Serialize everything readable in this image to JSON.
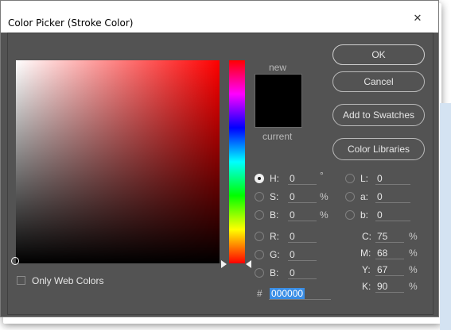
{
  "window": {
    "title": "Color Picker (Stroke Color)",
    "close_glyph": "✕"
  },
  "preview": {
    "new_label": "new",
    "current_label": "current",
    "color": "#000000"
  },
  "buttons": {
    "ok": "OK",
    "cancel": "Cancel",
    "add_to_swatches": "Add to Swatches",
    "color_libraries": "Color Libraries"
  },
  "hsb": [
    {
      "label": "H:",
      "value": "0",
      "unit": "°",
      "selected": true
    },
    {
      "label": "S:",
      "value": "0",
      "unit": "%",
      "selected": false
    },
    {
      "label": "B:",
      "value": "0",
      "unit": "%",
      "selected": false
    }
  ],
  "rgb": [
    {
      "label": "R:",
      "value": "0"
    },
    {
      "label": "G:",
      "value": "0"
    },
    {
      "label": "B:",
      "value": "0"
    }
  ],
  "lab": [
    {
      "label": "L:",
      "value": "0"
    },
    {
      "label": "a:",
      "value": "0"
    },
    {
      "label": "b:",
      "value": "0"
    }
  ],
  "cmyk": [
    {
      "label": "C:",
      "value": "75",
      "unit": "%"
    },
    {
      "label": "M:",
      "value": "68",
      "unit": "%"
    },
    {
      "label": "Y:",
      "value": "67",
      "unit": "%"
    },
    {
      "label": "K:",
      "value": "90",
      "unit": "%"
    }
  ],
  "hex": {
    "prefix": "#",
    "value": "000000"
  },
  "web_colors": {
    "label": "Only Web Colors",
    "checked": false
  },
  "colors": {
    "dialog_bg": "#535353",
    "accent": "#3a8ee6"
  }
}
